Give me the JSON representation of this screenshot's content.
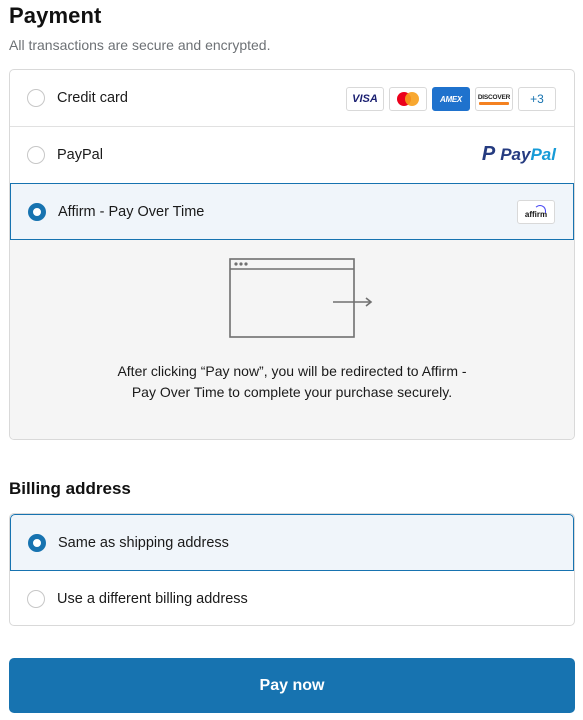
{
  "header": {
    "title": "Payment",
    "subtitle": "All transactions are secure and encrypted."
  },
  "payment_options": [
    {
      "label": "Credit card",
      "selected": false
    },
    {
      "label": "PayPal",
      "selected": false
    },
    {
      "label": "Affirm - Pay Over Time",
      "selected": true
    }
  ],
  "card_brands": {
    "visa": "VISA",
    "amex": "AMEX",
    "discover": "DISCOVER",
    "more": "+3"
  },
  "paypal_logo": {
    "part1": "Pay",
    "part2": "Pal"
  },
  "affirm_logo": {
    "text": "affirm"
  },
  "redirect": {
    "message": "After clicking “Pay now”, you will be redirected to Affirm - Pay Over Time to complete your purchase securely."
  },
  "billing": {
    "title": "Billing address",
    "options": [
      {
        "label": "Same as shipping address",
        "selected": true
      },
      {
        "label": "Use a different billing address",
        "selected": false
      }
    ]
  },
  "pay_button": {
    "label": "Pay now"
  },
  "colors": {
    "accent": "#1773b0",
    "selected_bg": "#f0f5fa"
  }
}
